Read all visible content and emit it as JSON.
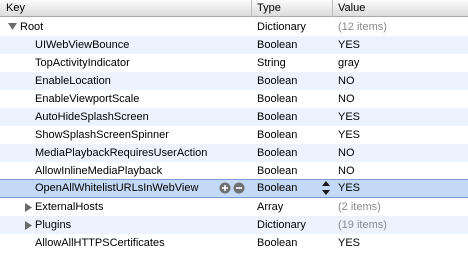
{
  "header": {
    "key": "Key",
    "type": "Type",
    "value": "Value"
  },
  "rows": [
    {
      "key": "Root",
      "type": "Dictionary",
      "value": "(12 items)",
      "dim": true,
      "expanded": true
    },
    {
      "key": "UIWebViewBounce",
      "type": "Boolean",
      "value": "YES"
    },
    {
      "key": "TopActivityIndicator",
      "type": "String",
      "value": "gray"
    },
    {
      "key": "EnableLocation",
      "type": "Boolean",
      "value": "NO"
    },
    {
      "key": "EnableViewportScale",
      "type": "Boolean",
      "value": "NO"
    },
    {
      "key": "AutoHideSplashScreen",
      "type": "Boolean",
      "value": "YES"
    },
    {
      "key": "ShowSplashScreenSpinner",
      "type": "Boolean",
      "value": "YES"
    },
    {
      "key": "MediaPlaybackRequiresUserAction",
      "type": "Boolean",
      "value": "NO"
    },
    {
      "key": "AllowInlineMediaPlayback",
      "type": "Boolean",
      "value": "NO"
    },
    {
      "key": "OpenAllWhitelistURLsInWebView",
      "type": "Boolean",
      "value": "YES",
      "selected": true
    },
    {
      "key": "ExternalHosts",
      "type": "Array",
      "value": "(2 items)",
      "dim": true,
      "collapsed": true
    },
    {
      "key": "Plugins",
      "type": "Dictionary",
      "value": "(19 items)",
      "dim": true,
      "collapsed": true
    },
    {
      "key": "AllowAllHTTPSCertificates",
      "type": "Boolean",
      "value": "YES"
    }
  ]
}
